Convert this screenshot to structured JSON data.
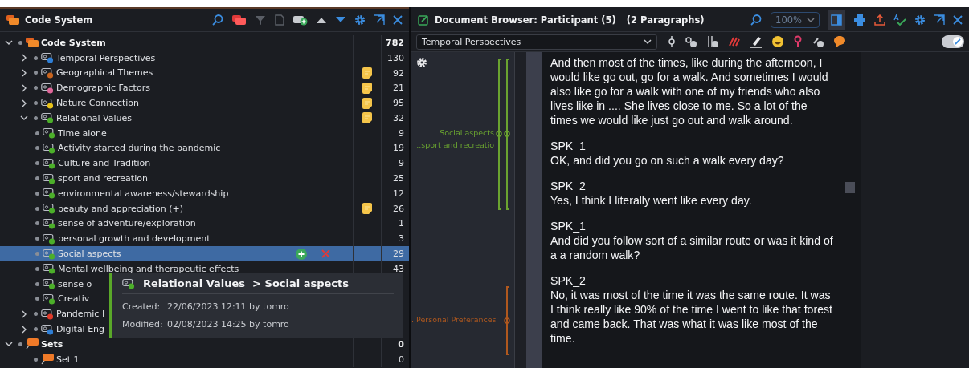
{
  "code_system": {
    "title": "Code System",
    "tree": [
      {
        "label": "Code System",
        "kind": "root",
        "count": "782",
        "memo": false,
        "selected": false,
        "expanded": true,
        "children": [
          {
            "label": "Temporal Perspectives",
            "kind": "code",
            "color": "#2f7fd6",
            "count": "130",
            "memo": false,
            "selected": false,
            "expanded": false
          },
          {
            "label": "Geographical Themes",
            "kind": "code",
            "color": "#c8641e",
            "count": "92",
            "memo": true,
            "selected": false,
            "expanded": false
          },
          {
            "label": "Demographic Factors",
            "kind": "code",
            "color": "#e0679a",
            "count": "21",
            "memo": true,
            "selected": false,
            "expanded": false
          },
          {
            "label": "Nature Connection",
            "kind": "code",
            "color": "#e8c21a",
            "count": "95",
            "memo": true,
            "selected": false,
            "expanded": false
          },
          {
            "label": "Relational Values",
            "kind": "code",
            "color": "#4caf2a",
            "count": "32",
            "memo": true,
            "selected": false,
            "expanded": true,
            "children": [
              {
                "label": "Time alone",
                "kind": "code",
                "color": "#4caf2a",
                "count": "9",
                "memo": false,
                "selected": false
              },
              {
                "label": "Activity started during the pandemic",
                "kind": "code",
                "color": "#4caf2a",
                "count": "19",
                "memo": false,
                "selected": false
              },
              {
                "label": "Culture and Tradition",
                "kind": "code",
                "color": "#4caf2a",
                "count": "9",
                "memo": false,
                "selected": false
              },
              {
                "label": "sport and recreation",
                "kind": "code",
                "color": "#4caf2a",
                "count": "25",
                "memo": false,
                "selected": false
              },
              {
                "label": "environmental awareness/stewardship",
                "kind": "code",
                "color": "#4caf2a",
                "count": "12",
                "memo": false,
                "selected": false
              },
              {
                "label": "beauty and appreciation (+)",
                "kind": "code",
                "color": "#4caf2a",
                "count": "26",
                "memo": true,
                "selected": false
              },
              {
                "label": "sense of adventure/exploration",
                "kind": "code",
                "color": "#4caf2a",
                "count": "1",
                "memo": false,
                "selected": false
              },
              {
                "label": "personal growth and development",
                "kind": "code",
                "color": "#4caf2a",
                "count": "3",
                "memo": false,
                "selected": false
              },
              {
                "label": "Social aspects",
                "kind": "code",
                "color": "#4caf2a",
                "count": "29",
                "memo": false,
                "selected": true
              },
              {
                "label": "Mental wellbeing and therapeutic effects",
                "kind": "code",
                "color": "#4caf2a",
                "count": "43",
                "memo": false,
                "selected": false
              },
              {
                "label": "sense o",
                "kind": "code",
                "color": "#4caf2a",
                "memo": false,
                "selected": false
              },
              {
                "label": "Creativ",
                "kind": "code",
                "color": "#4caf2a",
                "memo": false,
                "selected": false
              }
            ]
          },
          {
            "label": "Pandemic I",
            "kind": "code",
            "color": "#e03a2a",
            "memo": false,
            "selected": false,
            "expanded": false
          },
          {
            "label": "Digital Eng",
            "kind": "code",
            "color": "#2f7fd6",
            "memo": false,
            "selected": false,
            "expanded": false
          }
        ]
      },
      {
        "label": "Sets",
        "kind": "set",
        "count": "0",
        "memo": false,
        "selected": false,
        "expanded": true,
        "children": [
          {
            "label": "Set 1",
            "kind": "set",
            "count": "0",
            "memo": false,
            "selected": false
          }
        ]
      }
    ],
    "tooltip": {
      "title": "Relational Values  > Social aspects",
      "created_label": "Created:",
      "created": "22/06/2023 12:11 by tomro",
      "modified_label": "Modified:",
      "modified": "02/08/2023 14:25 by tomro"
    }
  },
  "document_browser": {
    "title": "Document Browser: Participant (5)",
    "paragraphs_count": "(2 Paragraphs)",
    "zoom": "100%",
    "code_filter": "Temporal Perspectives",
    "edit_mode": true,
    "margin_codes": [
      {
        "label": "..Social aspects",
        "color": "#6aa330"
      },
      {
        "label": "..sport and recreatio",
        "color": "#6aa330"
      },
      {
        "label": "..Personal Preferances",
        "color": "#b0581e"
      }
    ],
    "paragraphs": [
      {
        "text": "And then most of the times, like during the afternoon, I would like go out, go for a walk. And sometimes I would also like go for a walk with one of my friends who also lives like in .... She lives close to me. So a lot of the times we would like just go out and walk around."
      },
      {
        "speaker": "SPK_1",
        "text": "OK, and did you go on such a walk every day?"
      },
      {
        "speaker": "SPK_2",
        "text": "Yes, I think I literally went like every day."
      },
      {
        "speaker": "SPK_1",
        "text": "And did you follow sort of a similar route or was it kind of a a random walk?"
      },
      {
        "speaker": "SPK_2",
        "text": "No, it was most of the time it was the same route. It was I think really like 90% of the time I went to like that forest and came back. That was what it was like most of the time."
      }
    ]
  }
}
